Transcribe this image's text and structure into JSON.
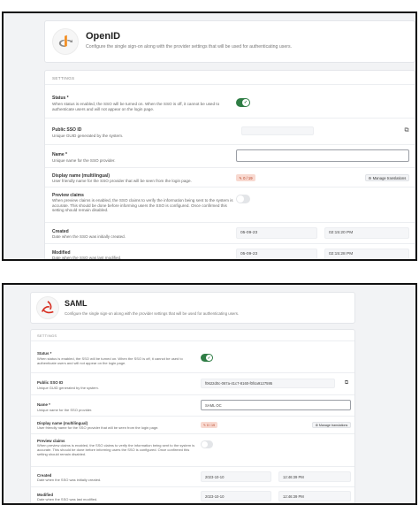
{
  "colors": {
    "toggle_on": "#2f7d45",
    "toggle_off": "#e3e5e8",
    "badge_bg": "#f8d9d0",
    "badge_text": "#b33c1e",
    "page_bg": "#f2f3f5"
  },
  "openid": {
    "logo_icon": "openid-logo-icon",
    "title": "OpenID",
    "description": "Configure the single sign-on along with the provider settings that will be used for authenticating users.",
    "section_label": "SETTINGS",
    "status": {
      "label": "Status *",
      "help": "When status is enabled, the SSO will be turned on. When the SSO is off, it cannot be used to authenticate users and will not appear on the login page.",
      "enabled": true
    },
    "public_sso_id": {
      "label": "Public SSO ID",
      "help": "Unique GUID generated by the system.",
      "value": ""
    },
    "name": {
      "label": "Name *",
      "help": "Unique name for the SSO provider.",
      "value": ""
    },
    "display_name": {
      "label": "Display name (multilingual)",
      "help": "User friendly name for the SSO provider that will be seen from the login page.",
      "badge": "0 / 19",
      "button": "Manage translations"
    },
    "preview_claims": {
      "label": "Preview claims",
      "help": "When preview claims is enabled, the SSO claims to verify the information being sent to the system is accurate. This should be done before informing users the SSO is configured. Once confirmed this setting should remain disabled.",
      "enabled": false
    },
    "created": {
      "label": "Created",
      "help": "Date when the SSO was initially created.",
      "date": "05-09-23",
      "time": "02:15:20 PM"
    },
    "modified": {
      "label": "Modified",
      "help": "Date when the SSO was last modified.",
      "date": "05-09-23",
      "time": "02:15:28 PM"
    }
  },
  "saml": {
    "logo_icon": "saml-logo-icon",
    "title": "SAML",
    "description": "Configure the single sign-on along with the provider settings that will be used for authenticating users.",
    "section_label": "SETTINGS",
    "status": {
      "label": "Status *",
      "help": "When status is enabled, the SSO will be turned on. When the SSO is off, it cannot be used to authenticate users and will not appear on the login page.",
      "enabled": true
    },
    "public_sso_id": {
      "label": "Public SSO ID",
      "help": "Unique GUID generated by the system.",
      "value": "f0622d0c-067a-41c7-8160-f0f4a9127595"
    },
    "name": {
      "label": "Name *",
      "help": "Unique name for the SSO provider.",
      "value": "SAML OC"
    },
    "display_name": {
      "label": "Display name (multilingual)",
      "help": "User friendly name for the SSO provider that will be seen from the login page.",
      "badge": "0 / 19",
      "button": "Manage translations"
    },
    "preview_claims": {
      "label": "Preview claims",
      "help": "When preview claims is enabled, the SSO claims to verify the information being sent to the system is accurate. This should be done before informing users the SSO is configured. Once confirmed this setting should remain disabled.",
      "enabled": false
    },
    "created": {
      "label": "Created",
      "help": "Date when the SSO was initially created.",
      "date": "2023-10-10",
      "time": "12:46:39 PM"
    },
    "modified": {
      "label": "Modified",
      "help": "Date when the SSO was last modified.",
      "date": "2023-10-10",
      "time": "12:46:39 PM"
    }
  }
}
